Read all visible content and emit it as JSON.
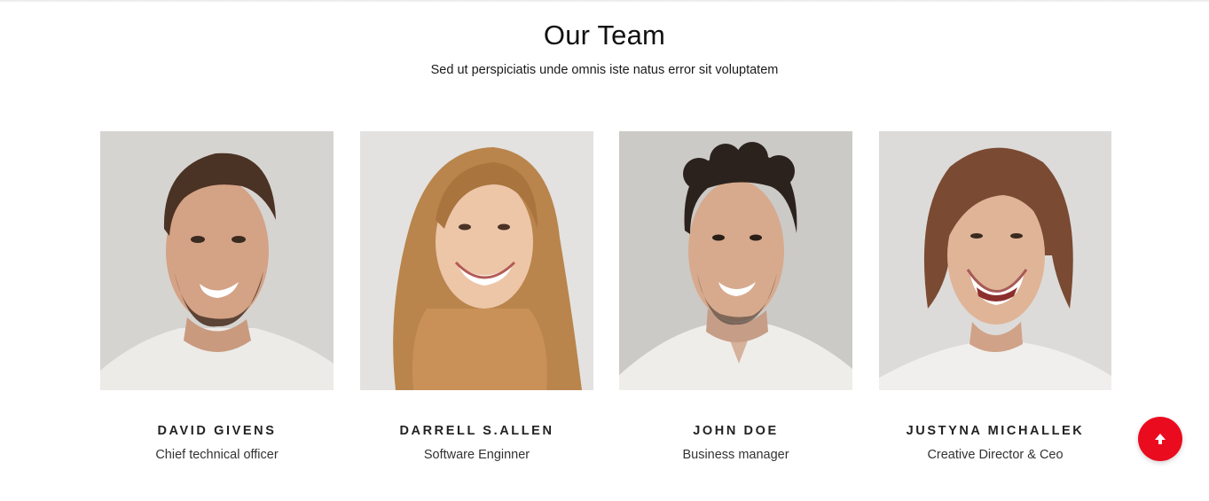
{
  "header": {
    "title": "Our Team",
    "subtitle": "Sed ut perspiciatis unde omnis iste natus error sit voluptatem"
  },
  "team": [
    {
      "name": "DAVID GIVENS",
      "role": "Chief technical officer",
      "photo": "man-short-hair-beard-photo"
    },
    {
      "name": "DARRELL S.ALLEN",
      "role": "Software Enginner",
      "photo": "woman-long-blonde-hair-photo"
    },
    {
      "name": "JOHN DOE",
      "role": "Business manager",
      "photo": "man-curly-hair-photo"
    },
    {
      "name": "JUSTYNA MICHALLEK",
      "role": "Creative Director & Ceo",
      "photo": "woman-bob-hair-laughing-photo"
    }
  ],
  "scroll_top": {
    "icon": "arrow-up-icon",
    "color": "#ea0b1f"
  }
}
